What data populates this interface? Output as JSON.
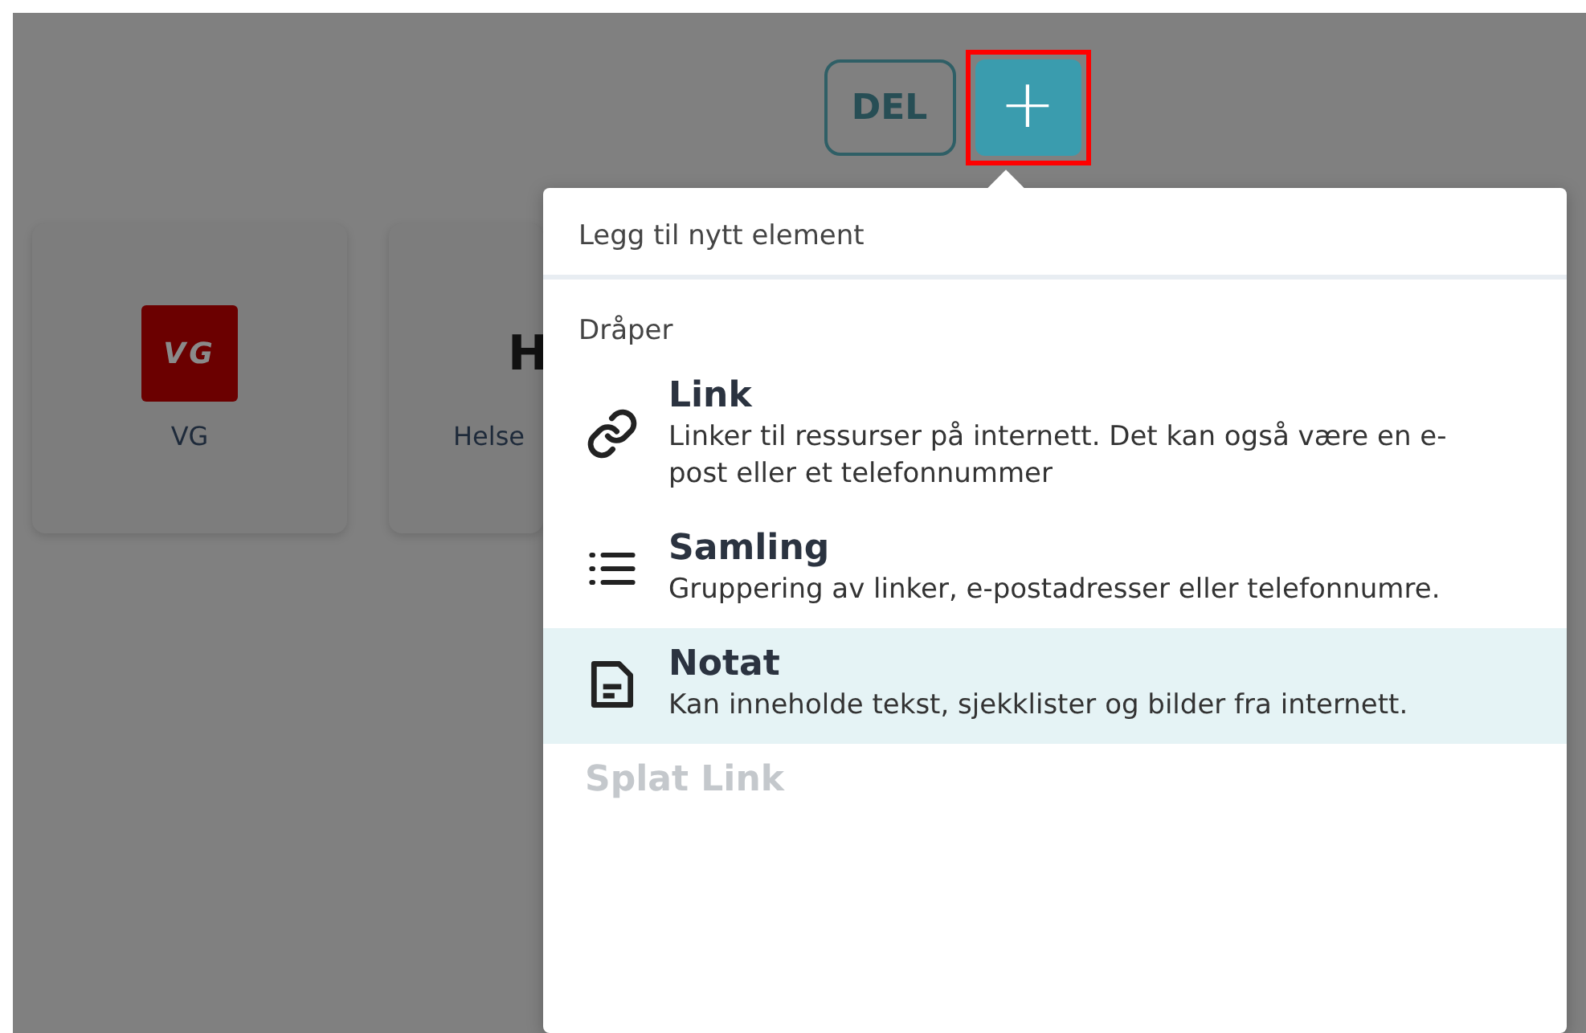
{
  "toolbar": {
    "share_label": "DEL",
    "add_button": {
      "label": "+",
      "highlighted": true
    }
  },
  "cards": [
    {
      "kind": "logo",
      "logo_text": "VG",
      "label": "VG"
    },
    {
      "kind": "letter",
      "logo_text": "H",
      "label": "Helse"
    }
  ],
  "menu": {
    "title": "Legg til nytt element",
    "section": "Dråper",
    "items": [
      {
        "kind": "link",
        "title": "Link",
        "description": "Linker til ressurser på internett. Det kan også være en e-post eller et telefonnummer",
        "selected": false,
        "disabled": false
      },
      {
        "kind": "list",
        "title": "Samling",
        "description": "Gruppering av linker, e-postadresser eller telefonnumre.",
        "selected": false,
        "disabled": false
      },
      {
        "kind": "note",
        "title": "Notat",
        "description": "Kan inneholde tekst, sjekklister og bilder fra internett.",
        "selected": true,
        "disabled": false
      },
      {
        "kind": "split",
        "title": "Splat Link",
        "selected": false,
        "disabled": true
      }
    ]
  }
}
